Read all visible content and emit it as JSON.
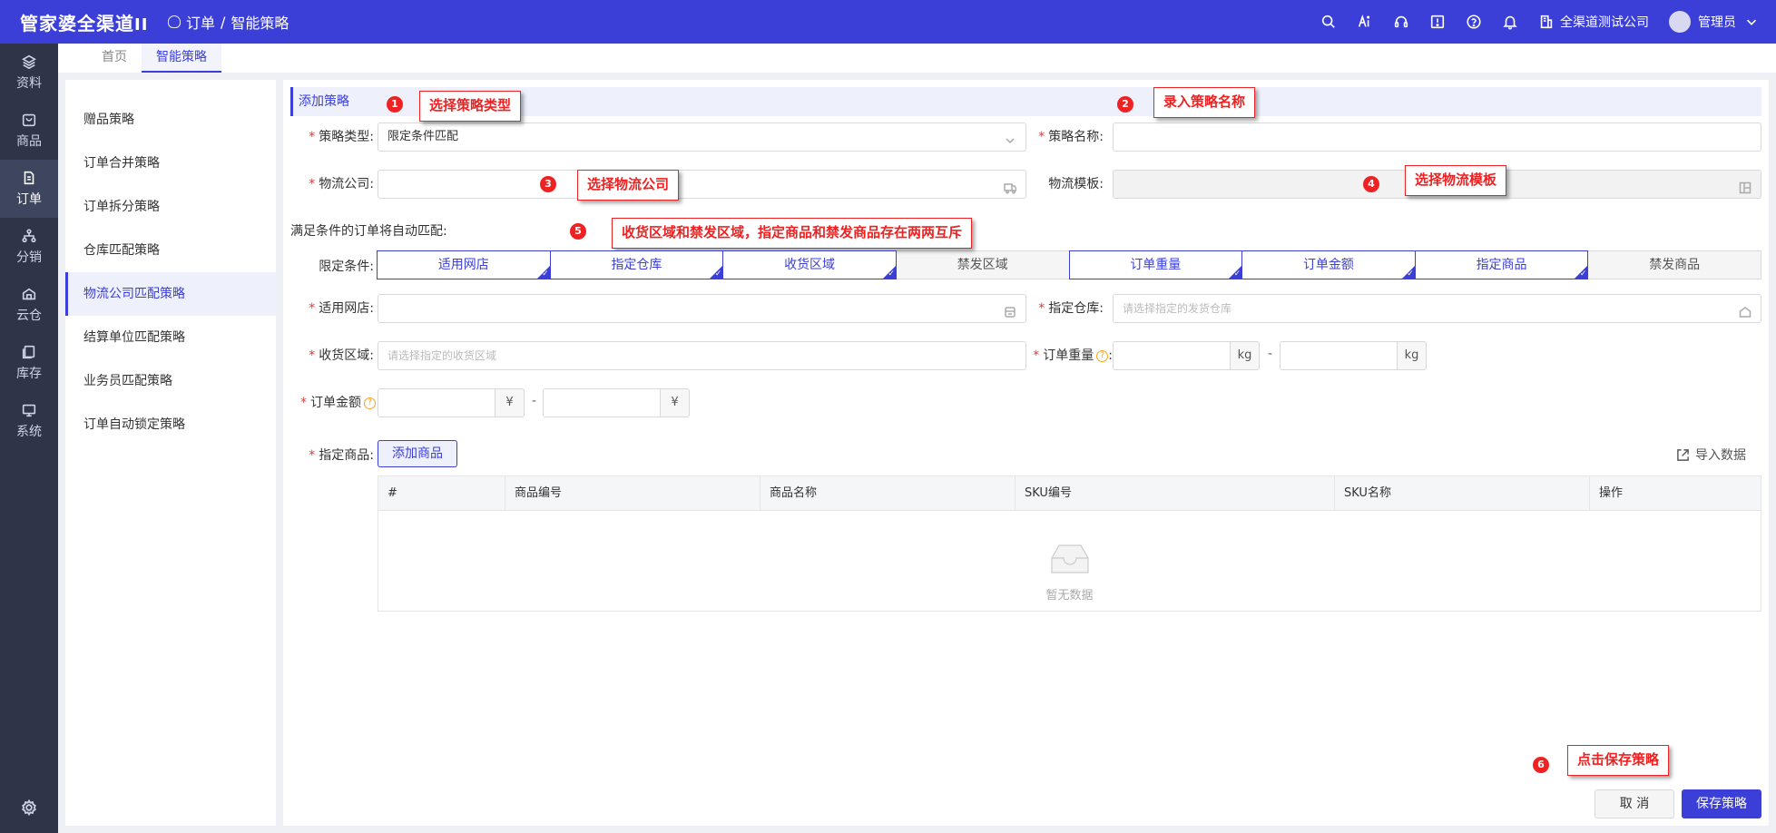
{
  "app": {
    "logo": "管家婆全渠道",
    "logo_suffix": "II",
    "breadcrumb": [
      "订单",
      "智能策略"
    ],
    "breadcrumb_sep": "/",
    "company": "全渠道测试公司",
    "user": "管理员"
  },
  "rail": [
    {
      "label": "资料",
      "icon": "layers-icon"
    },
    {
      "label": "商品",
      "icon": "goods-icon"
    },
    {
      "label": "订单",
      "icon": "order-icon",
      "active": true
    },
    {
      "label": "分销",
      "icon": "distribution-icon"
    },
    {
      "label": "云仓",
      "icon": "cloud-warehouse-icon"
    },
    {
      "label": "库存",
      "icon": "stock-icon"
    },
    {
      "label": "系统",
      "icon": "monitor-icon"
    }
  ],
  "tabs": [
    "首页",
    "智能策略"
  ],
  "subside": [
    "赠品策略",
    "订单合并策略",
    "订单拆分策略",
    "仓库匹配策略",
    "物流公司匹配策略",
    "结算单位匹配策略",
    "业务员匹配策略",
    "订单自动锁定策略"
  ],
  "form": {
    "section_title": "添加策略",
    "strategy_type_label": "策略类型:",
    "strategy_type_value": "限定条件匹配",
    "strategy_name_label": "策略名称:",
    "logistics_company_label": "物流公司:",
    "logistics_template_label": "物流模板:",
    "auto_match_hint": "满足条件的订单将自动匹配:",
    "conditions_label": "限定条件:",
    "conditions": [
      "适用网店",
      "指定仓库",
      "收货区域",
      "禁发区域",
      "订单重量",
      "订单金额",
      "指定商品",
      "禁发商品"
    ],
    "conditions_on": [
      true,
      true,
      true,
      false,
      true,
      true,
      true,
      false
    ],
    "shop_label": "适用网店:",
    "warehouse_label": "指定仓库:",
    "warehouse_placeholder": "请选择指定的发货仓库",
    "region_label": "收货区域:",
    "region_placeholder": "请选择指定的收货区域",
    "weight_label": "订单重量",
    "weight_unit": "kg",
    "amount_label": "订单金额",
    "amount_unit": "¥",
    "range_sep": "-",
    "colon": ":",
    "question_mark": "?",
    "goods_label": "指定商品:",
    "add_goods": "添加商品",
    "import_data": "导入数据",
    "table_headers": [
      "#",
      "商品编号",
      "商品名称",
      "SKU编号",
      "SKU名称",
      "操作"
    ],
    "empty_text": "暂无数据",
    "cancel": "取 消",
    "save": "保存策略"
  },
  "annotations": [
    {
      "num": "1",
      "text": "选择策略类型"
    },
    {
      "num": "2",
      "text": "录入策略名称"
    },
    {
      "num": "3",
      "text": "选择物流公司"
    },
    {
      "num": "4",
      "text": "选择物流模板"
    },
    {
      "num": "5",
      "text": "收货区域和禁发区域，指定商品和禁发商品存在两两互斥"
    },
    {
      "num": "6",
      "text": "点击保存策略"
    }
  ],
  "colors": {
    "brand": "#3b3fd8",
    "rail": "#2f3449",
    "annotation": "#e22222",
    "required": "#ee3333"
  }
}
